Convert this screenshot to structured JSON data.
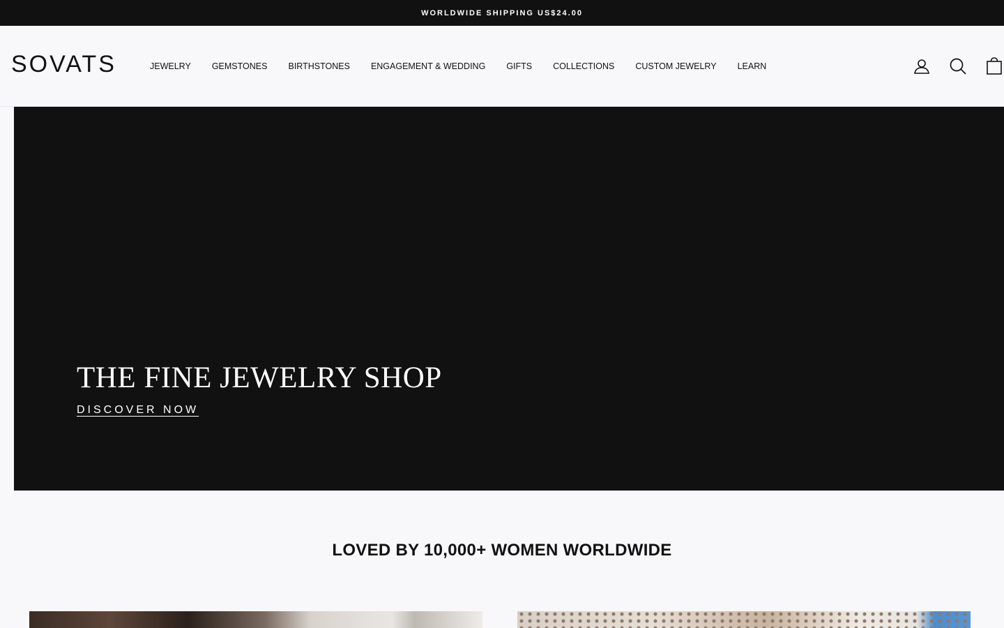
{
  "announcement": "WORLDWIDE SHIPPING US$24.00",
  "brand": "SOVATS",
  "nav": [
    {
      "label": "JEWELRY"
    },
    {
      "label": "GEMSTONES"
    },
    {
      "label": "BIRTHSTONES"
    },
    {
      "label": "ENGAGEMENT & WEDDING"
    },
    {
      "label": "GIFTS"
    },
    {
      "label": "COLLECTIONS"
    },
    {
      "label": "CUSTOM JEWELRY"
    },
    {
      "label": "LEARN"
    }
  ],
  "header_icons": [
    "user-icon",
    "search-icon",
    "cart-icon"
  ],
  "hero": {
    "title": "THE FINE JEWELRY SHOP",
    "cta": "DISCOVER NOW"
  },
  "section": {
    "heading": "LOVED BY 10,000+ WOMEN WORLDWIDE"
  },
  "colors": {
    "dark": "#111112",
    "background": "#f8f7fa",
    "text": "#111111"
  }
}
